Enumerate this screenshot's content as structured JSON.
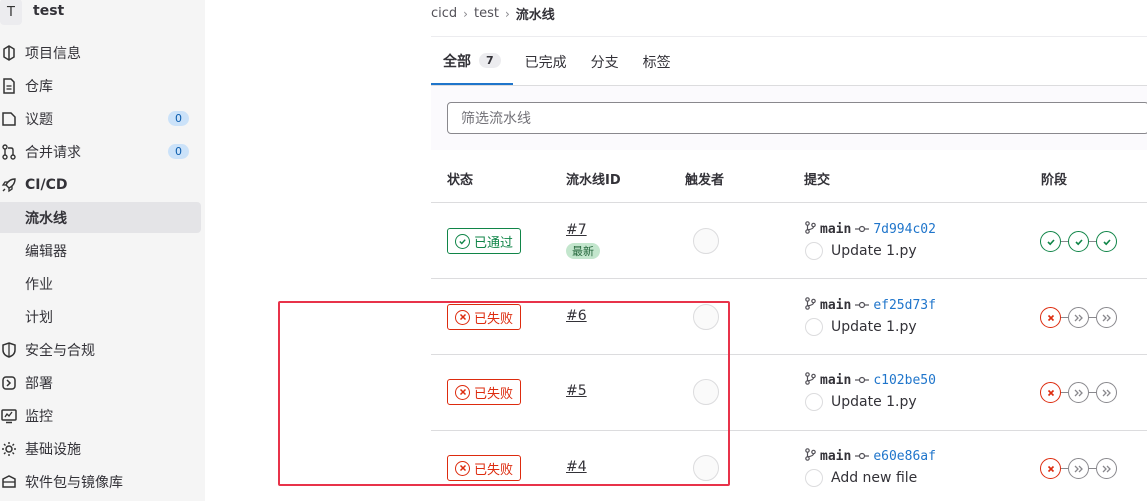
{
  "project": {
    "avatar_letter": "T",
    "name": "test"
  },
  "sidebar": {
    "items": [
      {
        "label": "项目信息",
        "icon": "project-icon"
      },
      {
        "label": "仓库",
        "icon": "document-icon"
      },
      {
        "label": "议题",
        "icon": "issues-icon",
        "count": "0"
      },
      {
        "label": "合并请求",
        "icon": "merge-request-icon",
        "count": "0"
      },
      {
        "label": "CI/CD",
        "icon": "rocket-icon"
      },
      {
        "label": "流水线"
      },
      {
        "label": "编辑器"
      },
      {
        "label": "作业"
      },
      {
        "label": "计划"
      },
      {
        "label": "安全与合规",
        "icon": "shield-icon"
      },
      {
        "label": "部署",
        "icon": "deploy-icon"
      },
      {
        "label": "监控",
        "icon": "monitor-icon"
      },
      {
        "label": "基础设施",
        "icon": "cloud-gear-icon"
      },
      {
        "label": "软件包与镜像库",
        "icon": "package-icon"
      }
    ]
  },
  "breadcrumb": {
    "items": [
      "cicd",
      "test",
      "流水线"
    ],
    "separator": "›"
  },
  "tabs": [
    {
      "label": "全部",
      "count": "7"
    },
    {
      "label": "已完成"
    },
    {
      "label": "分支"
    },
    {
      "label": "标签"
    }
  ],
  "filter": {
    "placeholder": "筛选流水线"
  },
  "table": {
    "headers": [
      "状态",
      "流水线ID",
      "触发者",
      "提交",
      "阶段"
    ],
    "rows": [
      {
        "status": "已通过",
        "id": "#7",
        "tag": "最新",
        "branch": "main",
        "sha": "7d994c02",
        "message": "Update 1.py",
        "stages": [
          "passed",
          "passed",
          "passed"
        ]
      },
      {
        "status": "已失败",
        "id": "#6",
        "branch": "main",
        "sha": "ef25d73f",
        "message": "Update 1.py",
        "stages": [
          "failed",
          "skipped",
          "skipped"
        ]
      },
      {
        "status": "已失败",
        "id": "#5",
        "branch": "main",
        "sha": "c102be50",
        "message": "Update 1.py",
        "stages": [
          "failed",
          "skipped",
          "skipped"
        ]
      },
      {
        "status": "已失败",
        "id": "#4",
        "branch": "main",
        "sha": "e60e86af",
        "message": "Add new file",
        "stages": [
          "failed",
          "skipped",
          "skipped"
        ]
      }
    ]
  },
  "colors": {
    "passed": "#108548",
    "failed": "#dd2b0e",
    "link": "#1f75cb",
    "highlight": "#e8334a"
  }
}
